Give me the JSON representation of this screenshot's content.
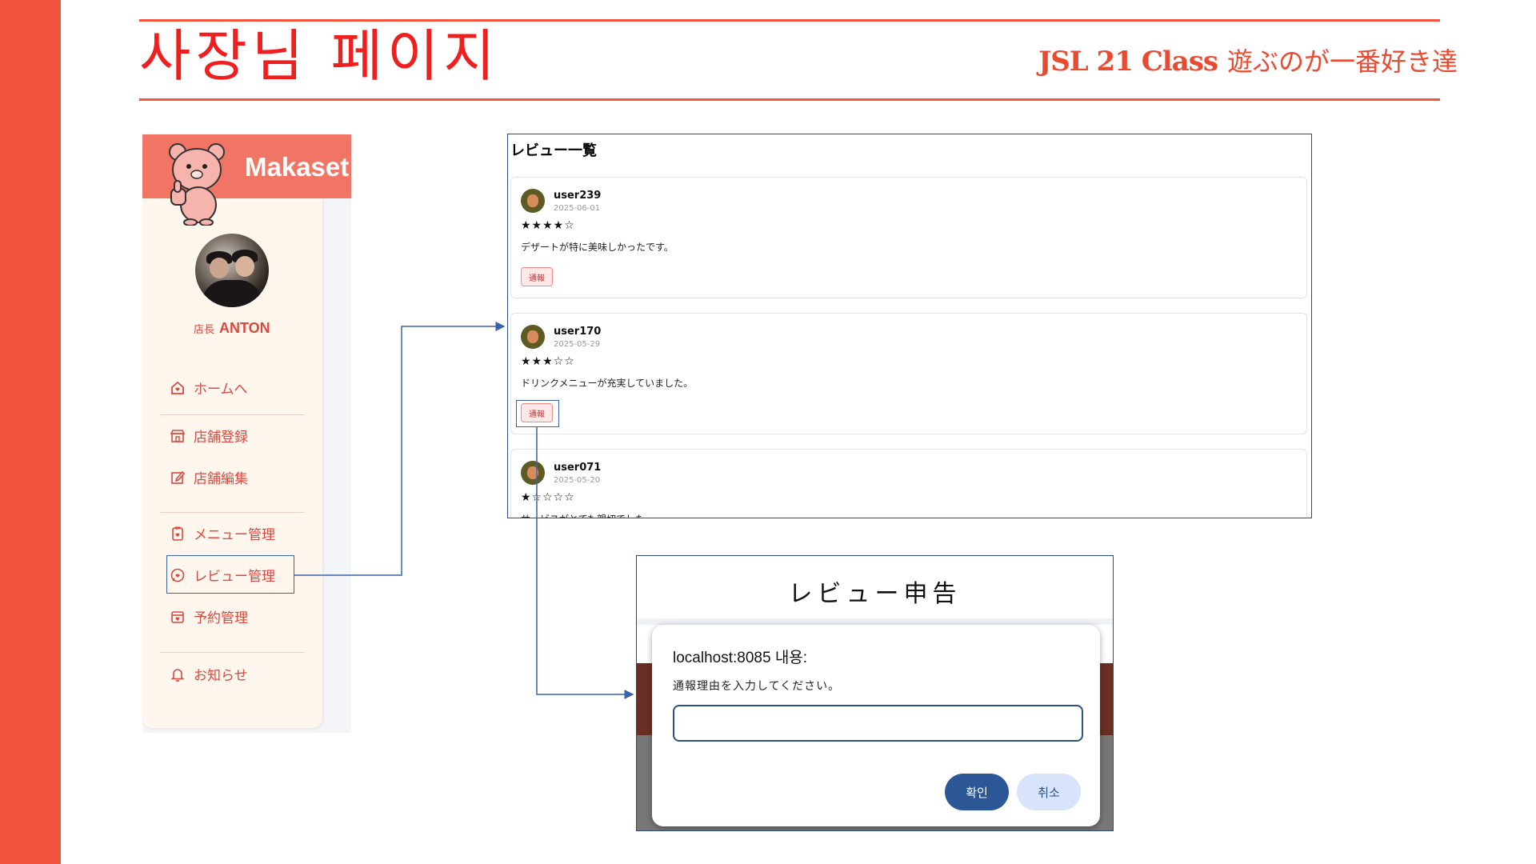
{
  "slide": {
    "title": "사장님 페이지",
    "brand_en": "JSL 21 Class",
    "brand_jp": "遊ぶのが一番好き達",
    "accent_color": "#f2543d"
  },
  "sidebar": {
    "logo": "Makaset",
    "owner_prefix": "店長",
    "owner_name": "ANTON",
    "items": [
      {
        "label": "ホームへ",
        "icon": "home-heart-icon"
      },
      {
        "label": "店舗登録",
        "icon": "store-icon"
      },
      {
        "label": "店舗編集",
        "icon": "edit-icon"
      },
      {
        "label": "メニュー管理",
        "icon": "clipboard-heart-icon"
      },
      {
        "label": "レビュー管理",
        "icon": "chat-heart-icon"
      },
      {
        "label": "予約管理",
        "icon": "calendar-heart-icon"
      },
      {
        "label": "お知らせ",
        "icon": "bell-icon"
      }
    ]
  },
  "reviews": {
    "title": "レビュー一覧",
    "report_label": "通報",
    "items": [
      {
        "user": "user239",
        "date": "2025-06-01",
        "stars": "★★★★☆",
        "text": "デザートが特に美味しかったです。"
      },
      {
        "user": "user170",
        "date": "2025-05-29",
        "stars": "★★★☆☆",
        "text": "ドリンクメニューが充実していました。"
      },
      {
        "user": "user071",
        "date": "2025-05-20",
        "stars": "★☆☆☆☆",
        "text": "サービスがとても親切でした。"
      }
    ]
  },
  "modal": {
    "title": "レビュー申告",
    "host": "localhost:8085 내용:",
    "message": "通報理由を入力してください。",
    "input_value": "",
    "ok_label": "확인",
    "cancel_label": "취소"
  }
}
